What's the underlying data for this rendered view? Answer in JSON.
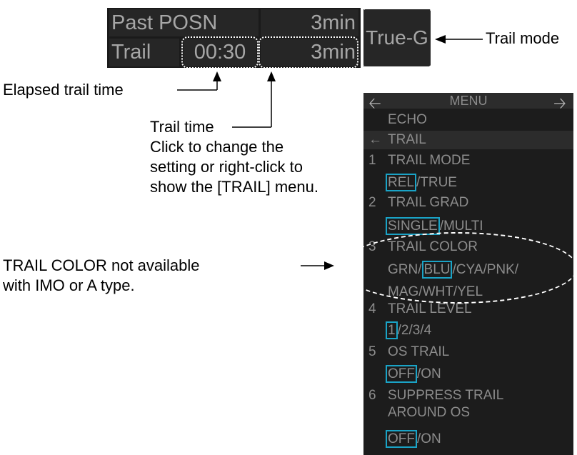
{
  "trail_panel": {
    "past_posn_label": "Past POSN",
    "past_posn_value": "3min",
    "trail_label": "Trail",
    "elapsed_time": "00:30",
    "trail_time": "3min",
    "trail_mode": "True-G"
  },
  "annotations": {
    "trail_mode": "Trail mode",
    "elapsed": "Elapsed trail time",
    "trail_time_lines": [
      "Trail time",
      "Click to change the",
      "setting or right-click to",
      "show the [TRAIL] menu."
    ],
    "color_note_lines": [
      "TRAIL COLOR not available",
      "with IMO or A type."
    ]
  },
  "menu": {
    "title": "MENU",
    "left_arrow_icon": "arrow-left-icon",
    "right_arrow_icon": "arrow-right-icon",
    "echo": "ECHO",
    "trail": "TRAIL",
    "items": [
      {
        "num": "1",
        "label": "TRAIL MODE",
        "options": [
          "REL",
          "TRUE"
        ],
        "selected": 0
      },
      {
        "num": "2",
        "label": "TRAIL GRAD",
        "options": [
          "SINGLE",
          "MULTI"
        ],
        "selected": 0
      },
      {
        "num": "3",
        "label": "TRAIL COLOR",
        "options_row1": [
          "GRN",
          "BLU",
          "CYA",
          "PNK"
        ],
        "options_row2": [
          "MAG",
          "WHT",
          "YEL"
        ],
        "selected": "BLU"
      },
      {
        "num": "4",
        "label": "TRAIL LEVEL",
        "options": [
          "1",
          "2",
          "3",
          "4"
        ],
        "selected": 0
      },
      {
        "num": "5",
        "label": "OS TRAIL",
        "options": [
          "OFF",
          "ON"
        ],
        "selected": 0
      },
      {
        "num": "6",
        "label_lines": [
          "SUPPRESS TRAIL",
          "AROUND OS"
        ],
        "options": [
          "OFF",
          "ON"
        ],
        "selected": 0
      }
    ],
    "separator": "/"
  },
  "colors": {
    "panel_bg": "#262626",
    "panel_text": "#a6a6a6",
    "menu_bg": "#1c1c1c",
    "menu_text": "#8c8c8c",
    "selection_box": "#1aa3c6"
  }
}
